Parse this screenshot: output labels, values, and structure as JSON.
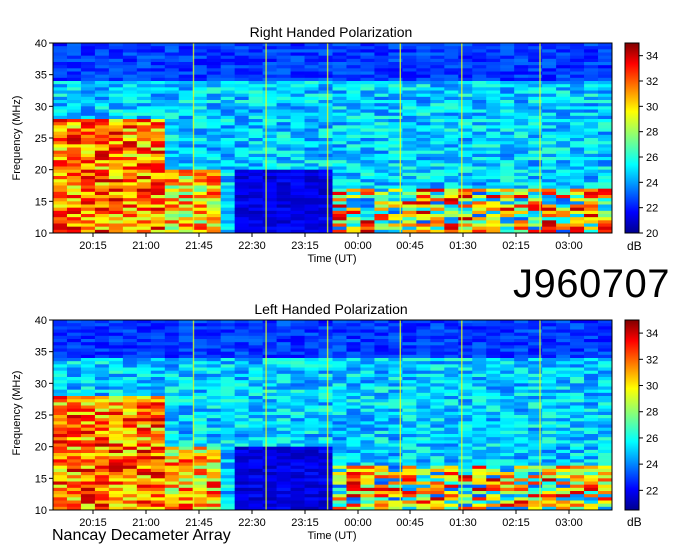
{
  "observation_id": "J960707",
  "footer": "Nancay Decameter Array",
  "chart_data": [
    {
      "type": "heatmap",
      "title": "Right Handed Polarization",
      "xlabel": "Time (UT)",
      "ylabel": "Frequency (MHz)",
      "x_ticks": [
        "20:15",
        "21:00",
        "21:45",
        "22:30",
        "23:15",
        "00:00",
        "00:45",
        "01:30",
        "02:15",
        "03:00"
      ],
      "y_ticks": [
        10,
        15,
        20,
        25,
        30,
        35,
        40
      ],
      "ylim": [
        10,
        40
      ],
      "colorbar": {
        "label": "dB",
        "ticks": [
          20,
          22,
          24,
          26,
          28,
          30,
          32,
          34
        ],
        "range": [
          20,
          35
        ]
      },
      "colormap": "jet"
    },
    {
      "type": "heatmap",
      "title": "Left Handed Polarization",
      "xlabel": "Time (UT)",
      "ylabel": "Frequency (MHz)",
      "x_ticks": [
        "20:15",
        "21:00",
        "21:45",
        "22:30",
        "23:15",
        "00:00",
        "00:45",
        "01:30",
        "02:15",
        "03:00"
      ],
      "y_ticks": [
        10,
        15,
        20,
        25,
        30,
        35,
        40
      ],
      "ylim": [
        10,
        40
      ],
      "colorbar": {
        "label": "dB",
        "ticks": [
          22,
          24,
          26,
          28,
          30,
          32,
          34
        ],
        "range": [
          20.5,
          35
        ]
      },
      "colormap": "jet"
    }
  ]
}
